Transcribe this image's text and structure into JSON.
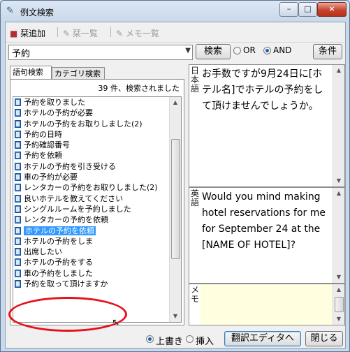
{
  "window": {
    "title": "例文検索",
    "title_icon": "pencil-icon",
    "minimize_label": "–",
    "maximize_label": "□",
    "close_label": "×"
  },
  "toolbar": {
    "add_label": "栞追加",
    "add_icon": "bookmark-icon",
    "list_label": "栞一覧",
    "list_icon": "bookmark-list-icon",
    "memo_list_label": "メモ一覧",
    "memo_icon": "memo-icon"
  },
  "search": {
    "query": "予約",
    "search_button": "検索",
    "or_label": "OR",
    "and_label": "AND",
    "selected_mode": "AND",
    "condition_button": "条件"
  },
  "tabs": [
    {
      "label": "語句検索",
      "active": true
    },
    {
      "label": "カテゴリ検索",
      "active": false
    }
  ],
  "results": {
    "count_text": "39 件、検索されました",
    "items": [
      "予約を取りました",
      "ホテルの予約が必要",
      "ホテルの予約をお取りしました(2)",
      "予約の日時",
      "予約確認番号",
      "予約を依頼",
      "ホテルの予約を引き受ける",
      "車の予約が必要",
      "レンタカーの予約をお取りしました(2)",
      "良いホテルを教えてください",
      "シングルルームを予約しました",
      "レンタカーの予約を依頼",
      "ホテルの予約を依頼",
      "ホテルの予約をしま",
      "出席したい",
      "ホテルの予約をする",
      "車の予約をしました",
      "予約を取って頂けますか"
    ],
    "selected_index": 12
  },
  "japanese_panel": {
    "label": "日本語",
    "text": "お手数ですが9月24日に[ホテル名]でホテルの予約をして頂けませんでしょうか。"
  },
  "english_panel": {
    "label": "英語",
    "text": "Would you mind making hotel reservations for me  for September 24 at the [NAME OF HOTEL]?"
  },
  "memo_panel": {
    "label": "メモ",
    "text": ""
  },
  "footer": {
    "overwrite_label": "上書き",
    "insert_label": "挿入",
    "selected_mode": "上書き",
    "translate_editor_button": "翻訳エディタへ",
    "close_button": "閉じる"
  },
  "colors": {
    "selection": "#3399ff",
    "annotation": "#e8101a",
    "memo_background": "#ffffe0"
  }
}
